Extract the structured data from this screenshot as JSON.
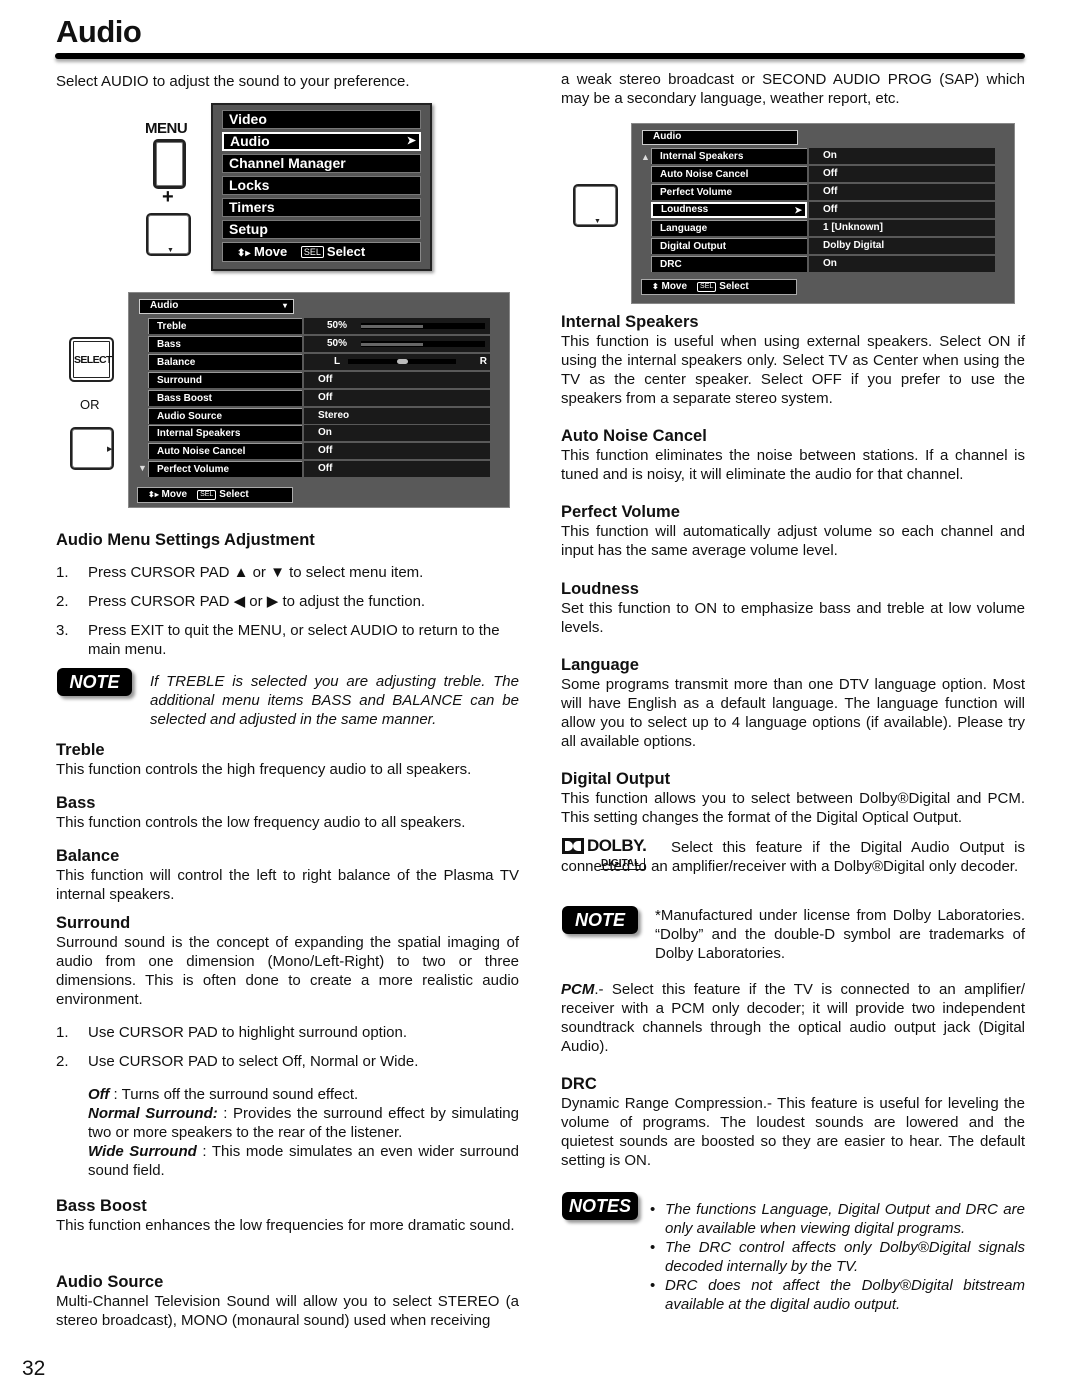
{
  "page": {
    "title": "Audio",
    "page_number": "32",
    "intro": "Select AUDIO to adjust the sound to your preference."
  },
  "remote": {
    "menu_label": "MENU",
    "plus": "+",
    "select_label": "SELECT",
    "or_label": "OR"
  },
  "main_menu": {
    "items": [
      {
        "label": "Video"
      },
      {
        "label": "Audio",
        "selected": true,
        "arrow": "➤"
      },
      {
        "label": "Channel Manager"
      },
      {
        "label": "Locks"
      },
      {
        "label": "Timers"
      },
      {
        "label": "Setup"
      }
    ],
    "footer_move": "Move",
    "footer_sel": "SEL",
    "footer_select": "Select",
    "move_icon": "↕▸"
  },
  "audio_menu_1": {
    "header": "Audio",
    "header_icon": "▾",
    "scroll_icon": "▼",
    "rows": [
      {
        "label": "Treble",
        "value": "50%",
        "level_percent": 50
      },
      {
        "label": "Bass",
        "value": "50%",
        "level_percent": 50
      },
      {
        "label": "Balance",
        "left": "L",
        "right": "R",
        "balance_position_percent": 50
      },
      {
        "label": "Surround",
        "value": "Off"
      },
      {
        "label": "Bass Boost",
        "value": "Off"
      },
      {
        "label": "Audio Source",
        "value": "Stereo"
      },
      {
        "label": "Internal Speakers",
        "value": "On"
      },
      {
        "label": "Auto Noise Cancel",
        "value": "Off"
      },
      {
        "label": "Perfect Volume",
        "value": "Off"
      }
    ],
    "footer_move": "Move",
    "footer_sel": "SEL",
    "footer_select": "Select"
  },
  "audio_menu_2": {
    "header": "Audio",
    "scroll_icon": "▲",
    "rows": [
      {
        "label": "Internal Speakers",
        "value": "On"
      },
      {
        "label": "Auto Noise Cancel",
        "value": "Off"
      },
      {
        "label": "Perfect Volume",
        "value": "Off"
      },
      {
        "label": "Loudness",
        "value": "Off",
        "selected": true,
        "arrow": "➤"
      },
      {
        "label": "Language",
        "value": "1 [Unknown]"
      },
      {
        "label": "Digital Output",
        "value": "Dolby Digital"
      },
      {
        "label": "DRC",
        "value": "On"
      }
    ],
    "footer_move": "Move",
    "footer_sel": "SEL",
    "footer_select": "Select"
  },
  "left": {
    "adjust_heading": "Audio Menu Settings Adjustment",
    "steps": [
      {
        "num": "1.",
        "text": "Press CURSOR PAD ▲ or ▼ to select menu item."
      },
      {
        "num": "2.",
        "text": "Press CURSOR PAD  ◀ or ▶ to adjust the function."
      },
      {
        "num": "3.",
        "text": "Press EXIT to quit the MENU, or select AUDIO to return to the main menu."
      }
    ],
    "note_badge": "NOTE",
    "note_text": "If TREBLE is selected you are adjusting treble. The additional menu items BASS and BALANCE can be selected and adjusted in the same manner.",
    "treble_h": "Treble",
    "treble_p": "This function controls the high frequency audio to all speakers.",
    "bass_h": "Bass",
    "bass_p": "This function controls the low frequency audio to all speakers.",
    "balance_h": "Balance",
    "balance_p": "This function will control the left to right balance of the Plasma TV internal speakers.",
    "surround_h": "Surround",
    "surround_p": "Surround sound is the concept of expanding the spatial imaging of audio from one dimension (Mono/Left-Right) to two or three dimensions. This is often done to create a more realistic audio environment.",
    "surround_steps": [
      {
        "num": "1.",
        "text": "Use CURSOR PAD to highlight surround option."
      },
      {
        "num": "2.",
        "text": "Use CURSOR PAD to select Off, Normal or Wide."
      }
    ],
    "off_term": "Off",
    "off_desc": " : Turns off the surround sound effect.",
    "normal_term": "Normal Surround:",
    "normal_desc": " : Provides the surround effect by simulating two or more speakers to the rear of the listener.",
    "wide_term": "Wide Surround",
    "wide_desc": " : This mode simulates an even wider surround sound field.",
    "bassboost_h": "Bass Boost",
    "bassboost_p": "This function enhances the low frequencies for more dramatic sound.",
    "audiosource_h": "Audio Source",
    "audiosource_p": "Multi-Channel Television Sound will allow you to select STEREO (a stereo broadcast), MONO (monaural sound) used when receiving"
  },
  "right": {
    "cont_p": "a weak stereo broadcast or SECOND AUDIO PROG (SAP) which may be a secondary language, weather report, etc.",
    "internal_h": "Internal Speakers",
    "internal_p": "This function is useful when using external speakers. Select ON if using the internal speakers only. Select TV as Center when using the TV as the center speaker. Select OFF if you prefer to use the speakers from a separate stereo system.",
    "anc_h": "Auto Noise Cancel",
    "anc_p": "This function eliminates the noise between stations. If a channel is tuned and is noisy, it will eliminate the audio for that channel.",
    "pv_h": "Perfect Volume",
    "pv_p": "This function will automatically adjust volume so each channel and input has the same average volume level.",
    "loud_h": "Loudness",
    "loud_p": "Set this function to ON to emphasize bass and treble at low volume levels.",
    "lang_h": "Language",
    "lang_p": "Some programs transmit more than one DTV language option. Most will have English as a default language. The language function will allow you to select up to 4 language options (if available). Please try all available options.",
    "dout_h": "Digital Output",
    "dout_p": "This function allows you to select between Dolby®Digital and PCM. This setting changes the format of the Digital Optical Output.",
    "dolby_logo_word": "DOLBY.",
    "dolby_logo_sub": "DIGITAL",
    "dolby_p": "Select this feature if the Digital Audio Output is connected to an amplifier/receiver with a Dolby®Digital only decoder.",
    "note_badge": "NOTE",
    "note_text": "*Manufactured under license from Dolby Laboratories. “Dolby” and the double-D symbol are trademarks of Dolby Laboratories.",
    "pcm_term": "PCM",
    "pcm_p": ".- Select this feature if the TV is connected to an amplifier/ receiver with a PCM only decoder; it will provide two independent soundtrack channels through the optical audio output jack (Digital Audio).",
    "drc_h": "DRC",
    "drc_p": "Dynamic Range Compression.- This feature is useful for leveling the volume of programs. The loudest sounds are lowered and the quietest sounds are boosted so they are easier to hear. The default setting is ON.",
    "notes_badge": "NOTES",
    "notes": [
      "The functions Language, Digital Output and DRC are only available when viewing digital programs.",
      "The DRC control affects only Dolby®Digital signals decoded internally by the TV.",
      "DRC does not affect the Dolby®Digital bitstream available at the digital audio output."
    ]
  }
}
